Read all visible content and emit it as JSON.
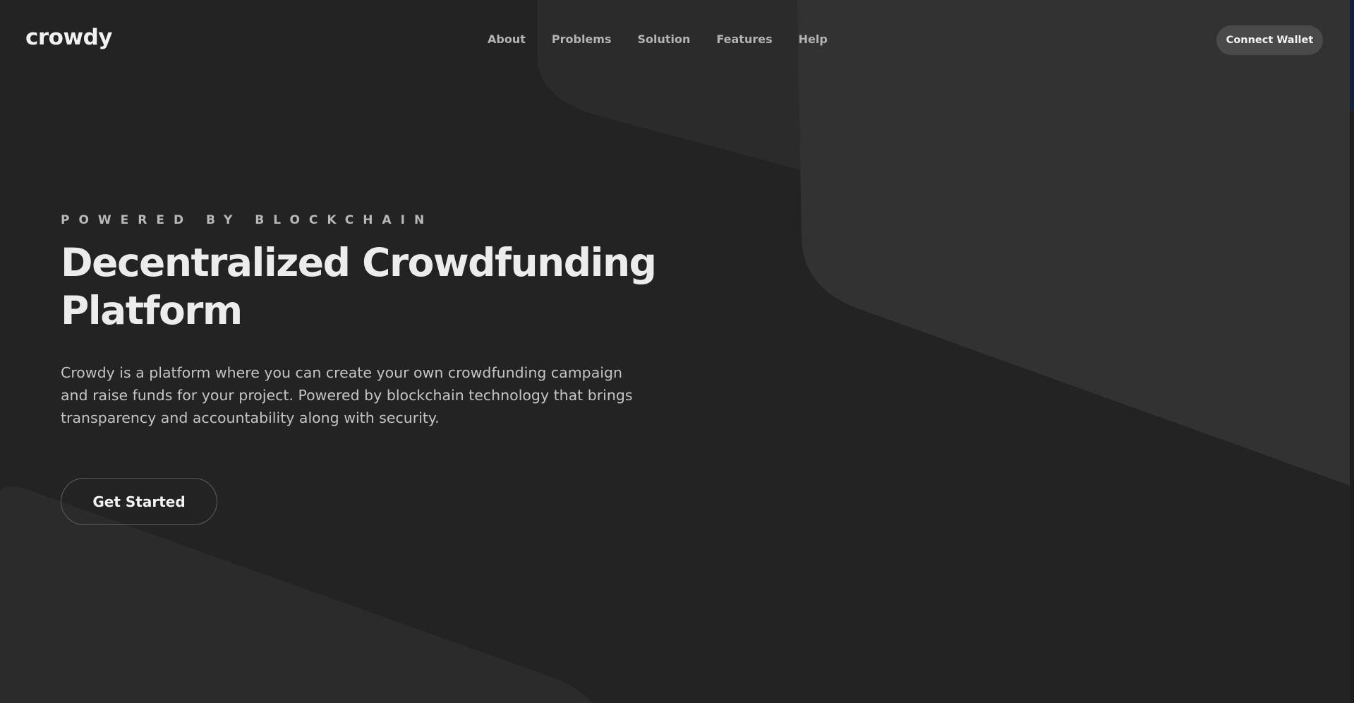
{
  "header": {
    "logo": "crowdy",
    "nav": [
      "About",
      "Problems",
      "Solution",
      "Features",
      "Help"
    ],
    "connect_label": "Connect Wallet"
  },
  "hero": {
    "eyebrow": "POWERED BY BLOCKCHAIN",
    "title_line1": "Decentralized Crowdfunding",
    "title_line2": "Platform",
    "desc_line1": "Crowdy is a platform where you can create your own crowdfunding campaign",
    "desc_line2": "and raise funds for your project. Powered by blockchain technology that brings",
    "desc_line3": "transparency and accountability along with security.",
    "cta_label": "Get Started"
  },
  "colors": {
    "background": "#232323",
    "shape": "#2f2f2f",
    "button_fill": "#4a4a4a",
    "text_primary": "#ececec",
    "text_muted": "#b4b4b4",
    "scrollbar_thumb": "#14213d"
  }
}
